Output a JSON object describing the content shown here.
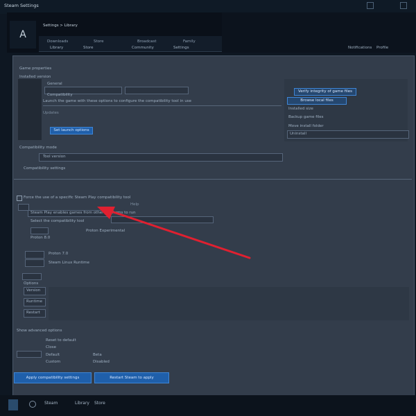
{
  "window": {
    "title": "Steam Settings",
    "tab_strip": "Library  ·  Store  ·  Community"
  },
  "header": {
    "logo": "A",
    "breadcrumb": "Settings > Library",
    "nav": [
      "Downloads",
      "Store",
      "Broadcast",
      "Family"
    ],
    "top_links": [
      "Library",
      "Store",
      "Community",
      "Settings"
    ],
    "right_links": [
      "Notifications",
      "Profile"
    ]
  },
  "panel": {
    "row1_label": "Game properties",
    "row2_label": "Installed version",
    "row3_text": "Launch the game with these options to configure the compatibility tool in use",
    "row_a": "General",
    "row_b": "Compatibility",
    "row_c": "Updates",
    "right_pill_1": "Verify integrity of game files",
    "right_pill_2": "Browse local files",
    "right_line_1": "Installed size",
    "right_line_2": "Backup game files",
    "right_line_3": "Move install folder",
    "right_line_4": "Uninstall",
    "blue_small": "Set launch options",
    "section_label": "Compatibility mode",
    "field_label": "Tool version",
    "section_title": "Compatibility settings",
    "check_label": "Force the use of a specific Steam Play compatibility tool",
    "note_label": "Help",
    "lines": [
      "Steam Play enables games from other platforms to run",
      "Select the compatibility tool",
      "Proton Experimental",
      "Proton 8.0",
      "Proton 7.0",
      "Steam Linux Runtime"
    ],
    "list_labels": [
      "Options",
      "Version",
      "Runtime",
      "Restart"
    ],
    "bottom_labels": [
      "Show advanced options",
      "Reset to default",
      "Close"
    ],
    "bottom_small": [
      "Default",
      "Custom",
      "Beta",
      "Disabled"
    ],
    "btn_left": "Apply compatibility settings",
    "btn_right": "Restart Steam to apply"
  },
  "taskbar": {
    "items": [
      "Steam",
      "Library",
      "Store"
    ]
  },
  "colors": {
    "accent": "#1f5faa",
    "arrow": "#e02030"
  }
}
